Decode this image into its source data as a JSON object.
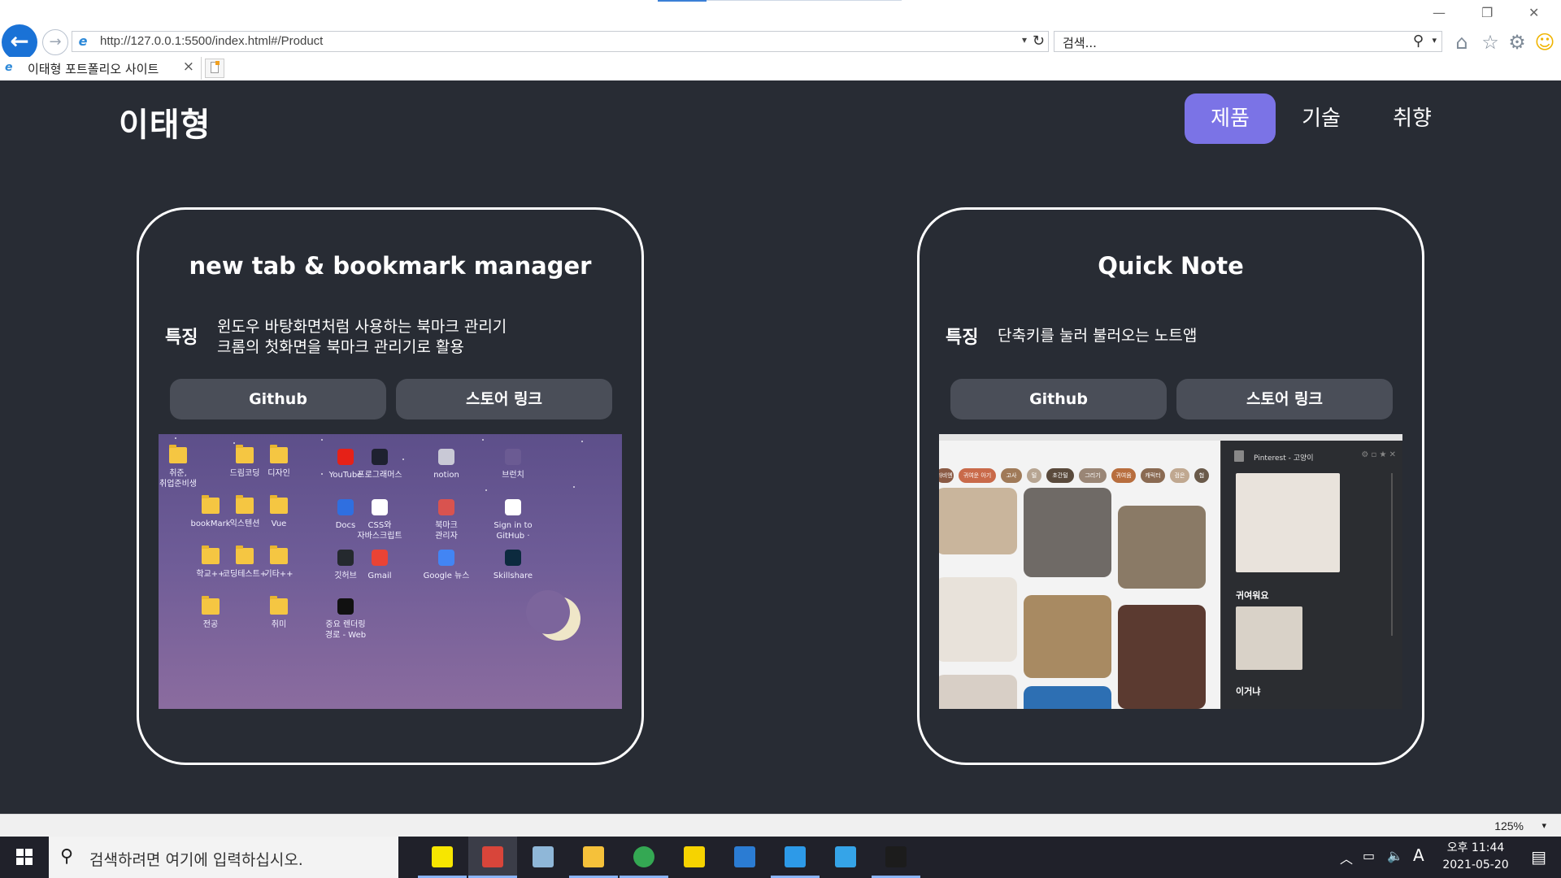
{
  "browser": {
    "url": "http://127.0.0.1:5500/index.html#/Product",
    "search_placeholder": "검색...",
    "tab_title": "이태형 포트폴리오 사이트",
    "tab_close": "×",
    "zoom": "125%"
  },
  "header": {
    "logo": "이태형",
    "nav": [
      {
        "label": "제품",
        "active": true
      },
      {
        "label": "기술",
        "active": false
      },
      {
        "label": "취향",
        "active": false
      }
    ]
  },
  "products": [
    {
      "title": "new tab & bookmark manager",
      "feature_label": "특징",
      "features": [
        "윈도우 바탕화면처럼 사용하는 북마크 관리기",
        "크롬의 첫화면을 북마크 관리기로 활용"
      ],
      "github_label": "Github",
      "store_label": "스토어 링크",
      "screenshot_items": [
        {
          "label": "취준,\n취업준비생",
          "kind": "folder"
        },
        {
          "label": "드림코딩",
          "kind": "folder"
        },
        {
          "label": "디자인",
          "kind": "folder"
        },
        {
          "label": "YouTube",
          "kind": "app",
          "color": "#e62117"
        },
        {
          "label": "프로그래머스",
          "kind": "app",
          "color": "#1e2130"
        },
        {
          "label": "notion",
          "kind": "app",
          "color": "#c9c9d6"
        },
        {
          "label": "브런치",
          "kind": "app",
          "color": "#6b5b93"
        },
        {
          "label": "bookMark",
          "kind": "folder"
        },
        {
          "label": "익스텐션",
          "kind": "folder"
        },
        {
          "label": "Vue",
          "kind": "folder"
        },
        {
          "label": "Docs",
          "kind": "app",
          "color": "#2f6fe0"
        },
        {
          "label": "CSS와\n자바스크립트",
          "kind": "app",
          "color": "#ffffff"
        },
        {
          "label": "북마크\n관리자",
          "kind": "app",
          "color": "#d9534f"
        },
        {
          "label": "Sign in to\nGitHub ·",
          "kind": "app",
          "color": "#ffffff"
        },
        {
          "label": "학교++",
          "kind": "folder"
        },
        {
          "label": "코딩테스트+",
          "kind": "folder"
        },
        {
          "label": "기타++",
          "kind": "folder"
        },
        {
          "label": "깃허브",
          "kind": "app",
          "color": "#24292e"
        },
        {
          "label": "Gmail",
          "kind": "app",
          "color": "#ea4335"
        },
        {
          "label": "Google 뉴스",
          "kind": "app",
          "color": "#4285f4"
        },
        {
          "label": "Skillshare",
          "kind": "app",
          "color": "#0c2a3e"
        },
        {
          "label": "전공",
          "kind": "folder"
        },
        {
          "label": "취미",
          "kind": "folder"
        },
        {
          "label": "중요 렌더링\n경로 - Web",
          "kind": "app",
          "color": "#111111"
        }
      ]
    },
    {
      "title": "Quick Note",
      "feature_label": "특징",
      "features": [
        "단축키를 눌러 불러오는 노트앱"
      ],
      "github_label": "Github",
      "store_label": "스토어 링크",
      "screenshot": {
        "chips": [
          "좌비엔",
          "귀여운 아기",
          "고사",
          "털",
          "초간털",
          "그리기",
          "귀여움",
          "캐릭터",
          "검은",
          "협"
        ],
        "panel_title": "Pinterest - 고양이",
        "note1": "귀여워요",
        "note2": "이거냐"
      }
    }
  ],
  "taskbar": {
    "search_placeholder": "검색하려면 여기에 입력하십시오.",
    "time": "오후 11:44",
    "date": "2021-05-20",
    "ime": "A",
    "apps": [
      {
        "name": "kakaotalk",
        "color": "#f7e600"
      },
      {
        "name": "paint",
        "color": "#d8453a"
      },
      {
        "name": "notes",
        "color": "#8fb7d8"
      },
      {
        "name": "file-explorer",
        "color": "#f5c13a"
      },
      {
        "name": "chrome",
        "color": "#34a853"
      },
      {
        "name": "sticky-notes",
        "color": "#f6d300"
      },
      {
        "name": "calendar",
        "color": "#2b7cd3"
      },
      {
        "name": "vscode",
        "color": "#2d9ae8"
      },
      {
        "name": "internet-explorer",
        "color": "#35a4e8"
      },
      {
        "name": "terminal",
        "color": "#1c1c1c"
      }
    ]
  }
}
